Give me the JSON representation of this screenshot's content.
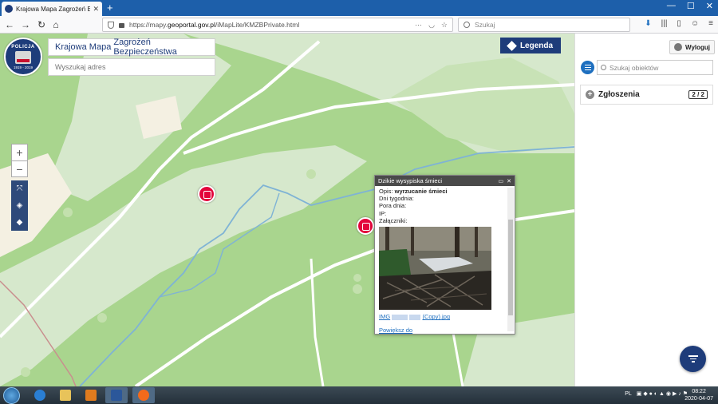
{
  "browser": {
    "tab_title": "Krajowa Mapa Zagrożeń Bezpie…",
    "url_prefix": "https://mapy.",
    "url_domain": "geoportal.gov.pl",
    "url_path": "/iMapLite/KMZBPrivate.html",
    "search_placeholder": "Szukaj"
  },
  "logo": {
    "top_text": "POLICJA",
    "bottom_text": "1919 - 2019"
  },
  "map": {
    "title_part1": "Krajowa Mapa ",
    "title_part2": "Zagrożeń Bezpieczeństwa",
    "address_placeholder": "Wyszukaj adres",
    "legend_label": "Legenda",
    "zoom_in": "+",
    "zoom_out": "−"
  },
  "popup": {
    "title": "Dzikie wysypiska śmieci",
    "opis_label": "Opis:",
    "opis_value": "wyrzucanie śmieci",
    "dni_label": "Dni tygodnia:",
    "pora_label": "Pora dnia:",
    "ip_label": "IP:",
    "zal_label": "Załączniki:",
    "file_prefix": "IMG",
    "file_suffix": "(Copy).jpg",
    "zoom_link": "Powiększ do"
  },
  "sidebar": {
    "logout_label": "Wyloguj",
    "search_placeholder": "Szukaj obiektów",
    "zgloszenia_label": "Zgłoszenia",
    "zgloszenia_count": "2 / 2"
  },
  "taskbar": {
    "lang": "PL",
    "time": "08:22",
    "date": "2020-04-07"
  },
  "colors": {
    "brand_navy": "#1e3c7a",
    "marker_red": "#e3063b",
    "map_green": "#a9d58e"
  }
}
